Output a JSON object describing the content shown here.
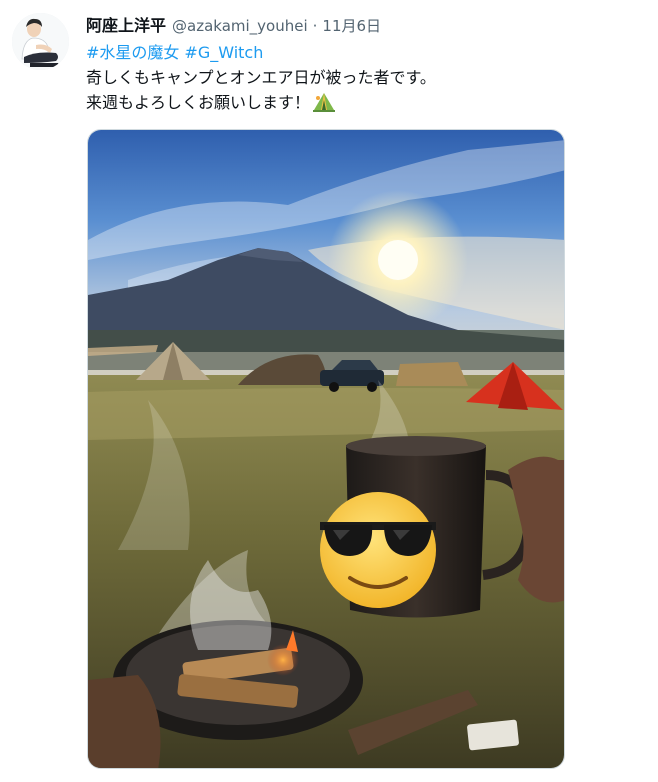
{
  "tweet": {
    "author": {
      "display_name": "阿座上洋平",
      "handle": "@azakami_youhei",
      "avatar_icon": "person-sitting-avatar"
    },
    "separator": "·",
    "date": "11月6日",
    "hashtags": [
      "#水星の魔女",
      "#G_Witch"
    ],
    "text_lines": [
      "奇しくもキャンプとオンエア日が被った者です。",
      "来週もよろしくお願いします！"
    ],
    "trailing_emoji": "camping-tent-emoji",
    "media": {
      "type": "photo",
      "scene_elements": [
        "mountain",
        "sun",
        "tents",
        "car",
        "campfire",
        "mug",
        "sunglasses-face-emoji",
        "smoke"
      ]
    }
  },
  "colors": {
    "link": "#1d9bf0",
    "text": "#0f1419",
    "secondary": "#536471",
    "border": "#cfd9de"
  }
}
